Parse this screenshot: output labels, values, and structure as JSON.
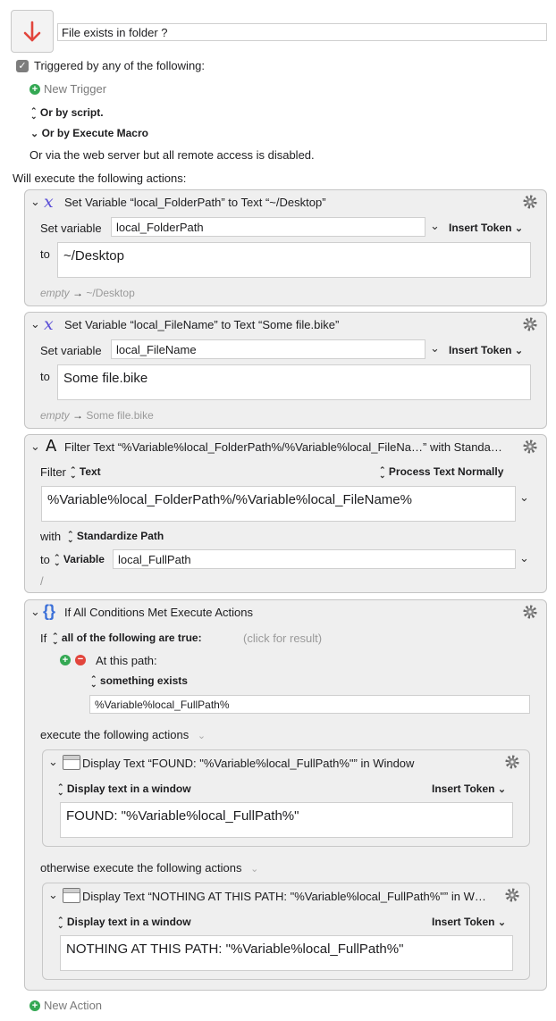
{
  "macro": {
    "title": "File exists in folder ?",
    "triggered_label": "Triggered by any of the following:",
    "new_trigger": "New Trigger",
    "or_by_script": "Or by script.",
    "or_by_execute_macro": "Or by Execute Macro",
    "web_server_note": "Or via the web server but all remote access is disabled.",
    "will_execute": "Will execute the following actions:",
    "new_action": "New Action"
  },
  "actions": [
    {
      "title": "Set Variable “local_FolderPath” to Text “~/Desktop”",
      "set_variable_label": "Set variable",
      "variable": "local_FolderPath",
      "insert_token": "Insert Token",
      "to_label": "to",
      "text": "~/Desktop",
      "preview_empty": "empty",
      "preview_value": "~/Desktop"
    },
    {
      "title": "Set Variable “local_FileName” to Text “Some file.bike”",
      "set_variable_label": "Set variable",
      "variable": "local_FileName",
      "insert_token": "Insert Token",
      "to_label": "to",
      "text": "Some file.bike",
      "preview_empty": "empty",
      "preview_value": "Some file.bike"
    },
    {
      "title": "Filter Text “%Variable%local_FolderPath%/%Variable%local_FileNa…” with Standa…",
      "filter_label": "Filter",
      "filter_source": "Text",
      "process_mode": "Process Text Normally",
      "text": "%Variable%local_FolderPath%/%Variable%local_FileName%",
      "with_label": "with",
      "filter_name": "Standardize Path",
      "to_label": "to",
      "to_kind": "Variable",
      "to_variable": "local_FullPath",
      "result": "/"
    },
    {
      "title": "If All Conditions Met Execute Actions",
      "if_label": "If",
      "condition_mode": "all of the following are true:",
      "click_result": "(click for result)",
      "condition_label": "At this path:",
      "condition_test": "something exists",
      "path": "%Variable%local_FullPath%",
      "then_label": "execute the following actions",
      "else_label": "otherwise execute the following actions",
      "then_action": {
        "title": "Display Text “FOUND: \"%Variable%local_FullPath%\"” in Window",
        "mode": "Display text in a window",
        "insert_token": "Insert Token",
        "text": "FOUND: \"%Variable%local_FullPath%\""
      },
      "else_action": {
        "title": "Display Text “NOTHING AT THIS PATH: \"%Variable%local_FullPath%\"” in W…",
        "mode": "Display text in a window",
        "insert_token": "Insert Token",
        "text": "NOTHING AT THIS PATH: \"%Variable%local_FullPath%\""
      }
    }
  ],
  "icons": {
    "macro_icon": "down-arrow-icon",
    "gear": "gear-icon",
    "variable": "variable-x-icon",
    "filter": "filter-a-icon",
    "if": "braces-icon",
    "window": "window-icon"
  },
  "colors": {
    "accent_red": "#e2453c",
    "add_green": "#34a853",
    "card_bg": "#efefef",
    "variable_purple": "#5b4fd6"
  }
}
